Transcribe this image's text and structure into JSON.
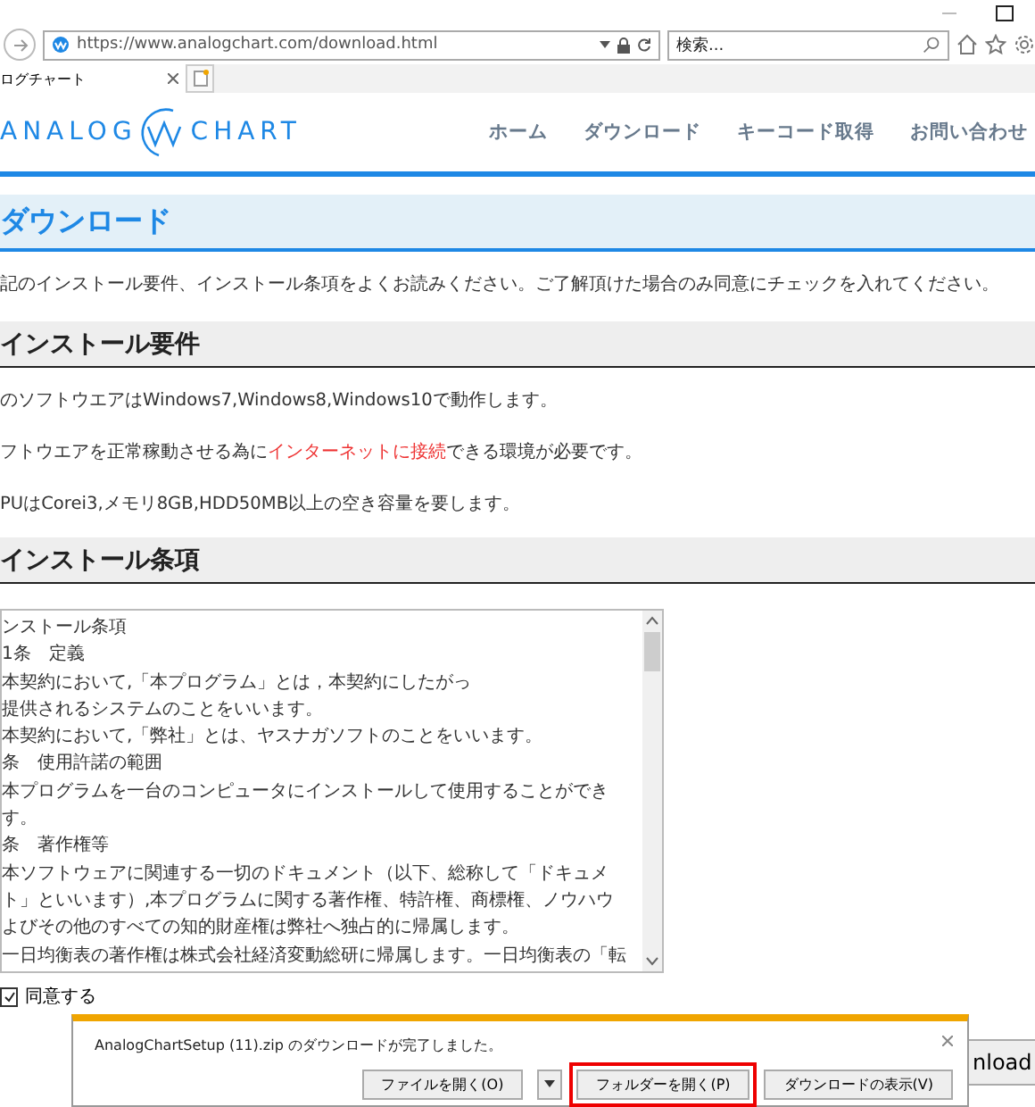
{
  "browser": {
    "url": "https://www.analogchart.com/download.html",
    "search": {
      "placeholder": "検索..."
    },
    "tab": {
      "title": "ログチャート"
    }
  },
  "site": {
    "logo_left": "ANALOG",
    "logo_right": "CHART",
    "nav": [
      "ホーム",
      "ダウンロード",
      "キーコード取得",
      "お問い合わせ"
    ]
  },
  "page_title": "ダウンロード",
  "intro": "記のインストール要件、インストール条項をよくお読みください。ご了解頂けた場合のみ同意にチェックを入れてください。",
  "requirements": {
    "heading": "インストール要件",
    "paragraphs": [
      [
        {
          "text": "のソフトウエアはWindows7,Windows8,Windows10で動作します。",
          "highlight": false
        }
      ],
      [
        {
          "text": "フトウエアを正常稼動させる為に",
          "highlight": false
        },
        {
          "text": "インターネットに接続",
          "highlight": true
        },
        {
          "text": "できる環境が必要です。",
          "highlight": false
        }
      ],
      [
        {
          "text": "PUはCorei3,メモリ8GB,HDD50MB以上の空き容量を要します。",
          "highlight": false
        }
      ]
    ]
  },
  "terms": {
    "heading": "インストール条項",
    "lines": [
      "ンストール条項",
      "1条　定義",
      "本契約において,「本プログラム」とは，本契約にしたがっ",
      "提供されるシステムのことをいいます。",
      "本契約において,「弊社」とは、ヤスナガソフトのことをいいます。",
      "条　使用許諾の範囲",
      "本プログラムを一台のコンピュータにインストールして使用することができ",
      "す。",
      "条　著作権等",
      "本ソフトウェアに関連する一切のドキュメント（以下、総称して「ドキュメ",
      "ト」といいます）,本プログラムに関する著作権、特許権、商標権、ノウハウ",
      "よびその他のすべての知的財産権は弊社へ独占的に帰属します。",
      "一日均衡表の著作権は株式会社経済変動総研に帰属します。一日均衡表の「転"
    ]
  },
  "agree": {
    "label": "同意する",
    "checked": true
  },
  "download_button": "nload",
  "notification": {
    "message": "AnalogChartSetup (11).zip のダウンロードが完了しました。",
    "buttons": [
      {
        "label": "ファイルを開く(O)",
        "kind": "split"
      },
      {
        "label": "フォルダーを開く(P)",
        "kind": "highlighted"
      },
      {
        "label": "ダウンロードの表示(V)",
        "kind": "plain"
      }
    ]
  }
}
